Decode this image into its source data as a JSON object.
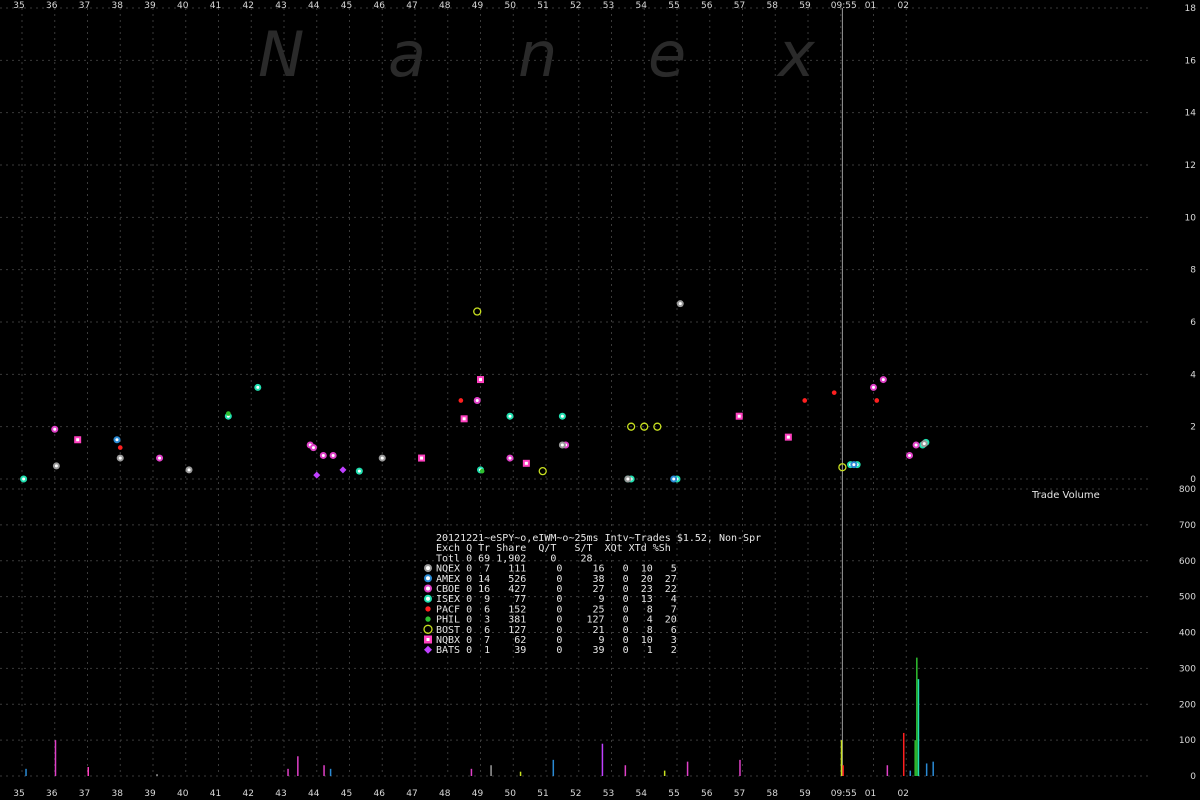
{
  "watermark": [
    "N",
    "a",
    "n",
    "e",
    "x"
  ],
  "volume_label": "Trade Volume",
  "chart_data": {
    "type": "scatter",
    "title": "20121221~eSPY~o,eIWM~o~25ms Intv~Trades $1.52, Non-Spr",
    "x_ticks": [
      "35",
      "36",
      "37",
      "38",
      "39",
      "40",
      "41",
      "42",
      "43",
      "44",
      "45",
      "46",
      "47",
      "48",
      "49",
      "50",
      "51",
      "52",
      "53",
      "54",
      "55",
      "56",
      "57",
      "58",
      "59",
      "09:55",
      "01",
      "02"
    ],
    "y_ticks_top": [
      "0",
      "2",
      "4",
      "6",
      "8",
      "10",
      "12",
      "14",
      "16",
      "18"
    ],
    "y_ticks_bottom": [
      "0",
      "100",
      "200",
      "300",
      "400",
      "500",
      "600",
      "700",
      "800"
    ],
    "ylim_top": [
      0,
      18
    ],
    "ylim_bottom": [
      0,
      800
    ],
    "grid": true,
    "marker_line_x": 25.05,
    "legend": {
      "title": "20121221~eSPY~o,eIWM~o~25ms Intv~Trades $1.52, Non-Spr",
      "header": "Exch Q Tr Share  Q/T   S/T  XQt XTd %Sh",
      "total": "Totl 0 69 1,902    0    28",
      "rows": [
        {
          "name": "NQEX",
          "text": "NQEX 0  7   111     0     16   0  10   5",
          "color": "#9a9a9a",
          "shape": "circle"
        },
        {
          "name": "AMEX",
          "text": "AMEX 0 14   526     0     38   0  20  27",
          "color": "#2a8ad4",
          "shape": "circle"
        },
        {
          "name": "CBOE",
          "text": "CBOE 0 16   427     0     27   0  23  22",
          "color": "#e040c8",
          "shape": "circle"
        },
        {
          "name": "ISEX",
          "text": "ISEX 0  9    77     0      9   0  13   4",
          "color": "#20e0b0",
          "shape": "circle"
        },
        {
          "name": "PACF",
          "text": "PACF 0  6   152     0     25   0   8   7",
          "color": "#ff2020",
          "shape": "dot"
        },
        {
          "name": "PHIL",
          "text": "PHIL 0  3   381     0    127   0   4  20",
          "color": "#30c030",
          "shape": "dot"
        },
        {
          "name": "BOST",
          "text": "BOST 0  6   127     0     21   0   8   6",
          "color": "#c8e020",
          "shape": "ring"
        },
        {
          "name": "NQBX",
          "text": "NQBX 0  7    62     0      9   0  10   3",
          "color": "#ff40c0",
          "shape": "square"
        },
        {
          "name": "BATS",
          "text": "BATS 0  1    39     0     39   0   1   2",
          "color": "#c040ff",
          "shape": "diamond"
        }
      ]
    },
    "series": [
      {
        "exch": "ISEX",
        "points": [
          [
            0.05,
            0.0
          ],
          [
            6.3,
            2.4
          ],
          [
            7.2,
            3.5
          ],
          [
            10.3,
            0.3
          ],
          [
            14.0,
            0.35
          ],
          [
            14.9,
            2.4
          ],
          [
            16.5,
            2.4
          ],
          [
            18.5,
            0.0
          ],
          [
            18.6,
            0.0
          ],
          [
            20.0,
            0.0
          ],
          [
            25.3,
            0.55
          ],
          [
            25.5,
            0.55
          ],
          [
            27.5,
            1.3
          ],
          [
            27.6,
            1.4
          ]
        ]
      },
      {
        "exch": "CBOE",
        "points": [
          [
            1.0,
            1.9
          ],
          [
            4.2,
            0.8
          ],
          [
            8.8,
            1.3
          ],
          [
            8.9,
            1.2
          ],
          [
            9.2,
            0.9
          ],
          [
            9.5,
            0.9
          ],
          [
            13.9,
            3.0
          ],
          [
            14.9,
            0.8
          ],
          [
            16.6,
            1.3
          ],
          [
            26.0,
            3.5
          ],
          [
            26.3,
            3.8
          ],
          [
            27.1,
            0.9
          ],
          [
            27.3,
            1.3
          ]
        ]
      },
      {
        "exch": "NQEX",
        "points": [
          [
            1.05,
            0.5
          ],
          [
            3.0,
            0.8
          ],
          [
            5.1,
            0.35
          ],
          [
            11.0,
            0.8
          ],
          [
            16.5,
            1.3
          ],
          [
            18.5,
            0.0
          ],
          [
            20.1,
            6.7
          ],
          [
            27.55,
            1.35
          ]
        ]
      },
      {
        "exch": "AMEX",
        "points": [
          [
            2.9,
            1.5
          ],
          [
            19.9,
            0.0
          ],
          [
            25.4,
            0.55
          ]
        ]
      },
      {
        "exch": "PACF",
        "points": [
          [
            3.0,
            1.2
          ],
          [
            13.4,
            3.0
          ],
          [
            23.9,
            3.0
          ],
          [
            24.8,
            3.3
          ],
          [
            26.1,
            3.0
          ]
        ]
      },
      {
        "exch": "PHIL",
        "points": [
          [
            6.3,
            2.5
          ],
          [
            14.05,
            0.3
          ]
        ]
      },
      {
        "exch": "BOST",
        "points": [
          [
            13.9,
            6.4
          ],
          [
            15.9,
            0.3
          ],
          [
            18.6,
            2.0
          ],
          [
            19.0,
            2.0
          ],
          [
            19.4,
            2.0
          ],
          [
            25.05,
            0.45
          ]
        ]
      },
      {
        "exch": "NQBX",
        "points": [
          [
            1.7,
            1.5
          ],
          [
            12.2,
            0.8
          ],
          [
            15.4,
            0.6
          ],
          [
            21.9,
            2.4
          ],
          [
            14.0,
            3.8
          ],
          [
            23.4,
            1.6
          ],
          [
            13.5,
            2.3
          ]
        ]
      },
      {
        "exch": "BATS",
        "points": [
          [
            9.8,
            0.35
          ],
          [
            9.0,
            0.15
          ]
        ]
      }
    ],
    "volume_bars": [
      [
        0.1,
        20,
        "#2a8ad4"
      ],
      [
        1.0,
        100,
        "#e040c8"
      ],
      [
        2.0,
        25,
        "#ff40c0"
      ],
      [
        4.1,
        5,
        "#9a9a9a"
      ],
      [
        8.1,
        20,
        "#e040c8"
      ],
      [
        8.4,
        55,
        "#e040c8"
      ],
      [
        9.2,
        30,
        "#e040c8"
      ],
      [
        9.4,
        20,
        "#2a8ad4"
      ],
      [
        13.7,
        20,
        "#e040c8"
      ],
      [
        14.3,
        30,
        "#9a9a9a"
      ],
      [
        15.2,
        12,
        "#c8e020"
      ],
      [
        16.2,
        45,
        "#2a8ad4"
      ],
      [
        17.7,
        90,
        "#c040ff"
      ],
      [
        18.4,
        30,
        "#e040c8"
      ],
      [
        19.6,
        15,
        "#c8e020"
      ],
      [
        20.3,
        40,
        "#e040c8"
      ],
      [
        21.9,
        45,
        "#e040c8"
      ],
      [
        25.0,
        100,
        "#c8e020"
      ],
      [
        25.05,
        30,
        "#ff2020"
      ],
      [
        26.4,
        30,
        "#e040c8"
      ],
      [
        26.9,
        120,
        "#ff2020"
      ],
      [
        27.1,
        15,
        "#2a8ad4"
      ],
      [
        27.25,
        100,
        "#30c030"
      ],
      [
        27.3,
        330,
        "#30c030"
      ],
      [
        27.35,
        270,
        "#20e0b0"
      ],
      [
        27.6,
        35,
        "#2a8ad4"
      ],
      [
        27.8,
        40,
        "#2a8ad4"
      ]
    ]
  }
}
